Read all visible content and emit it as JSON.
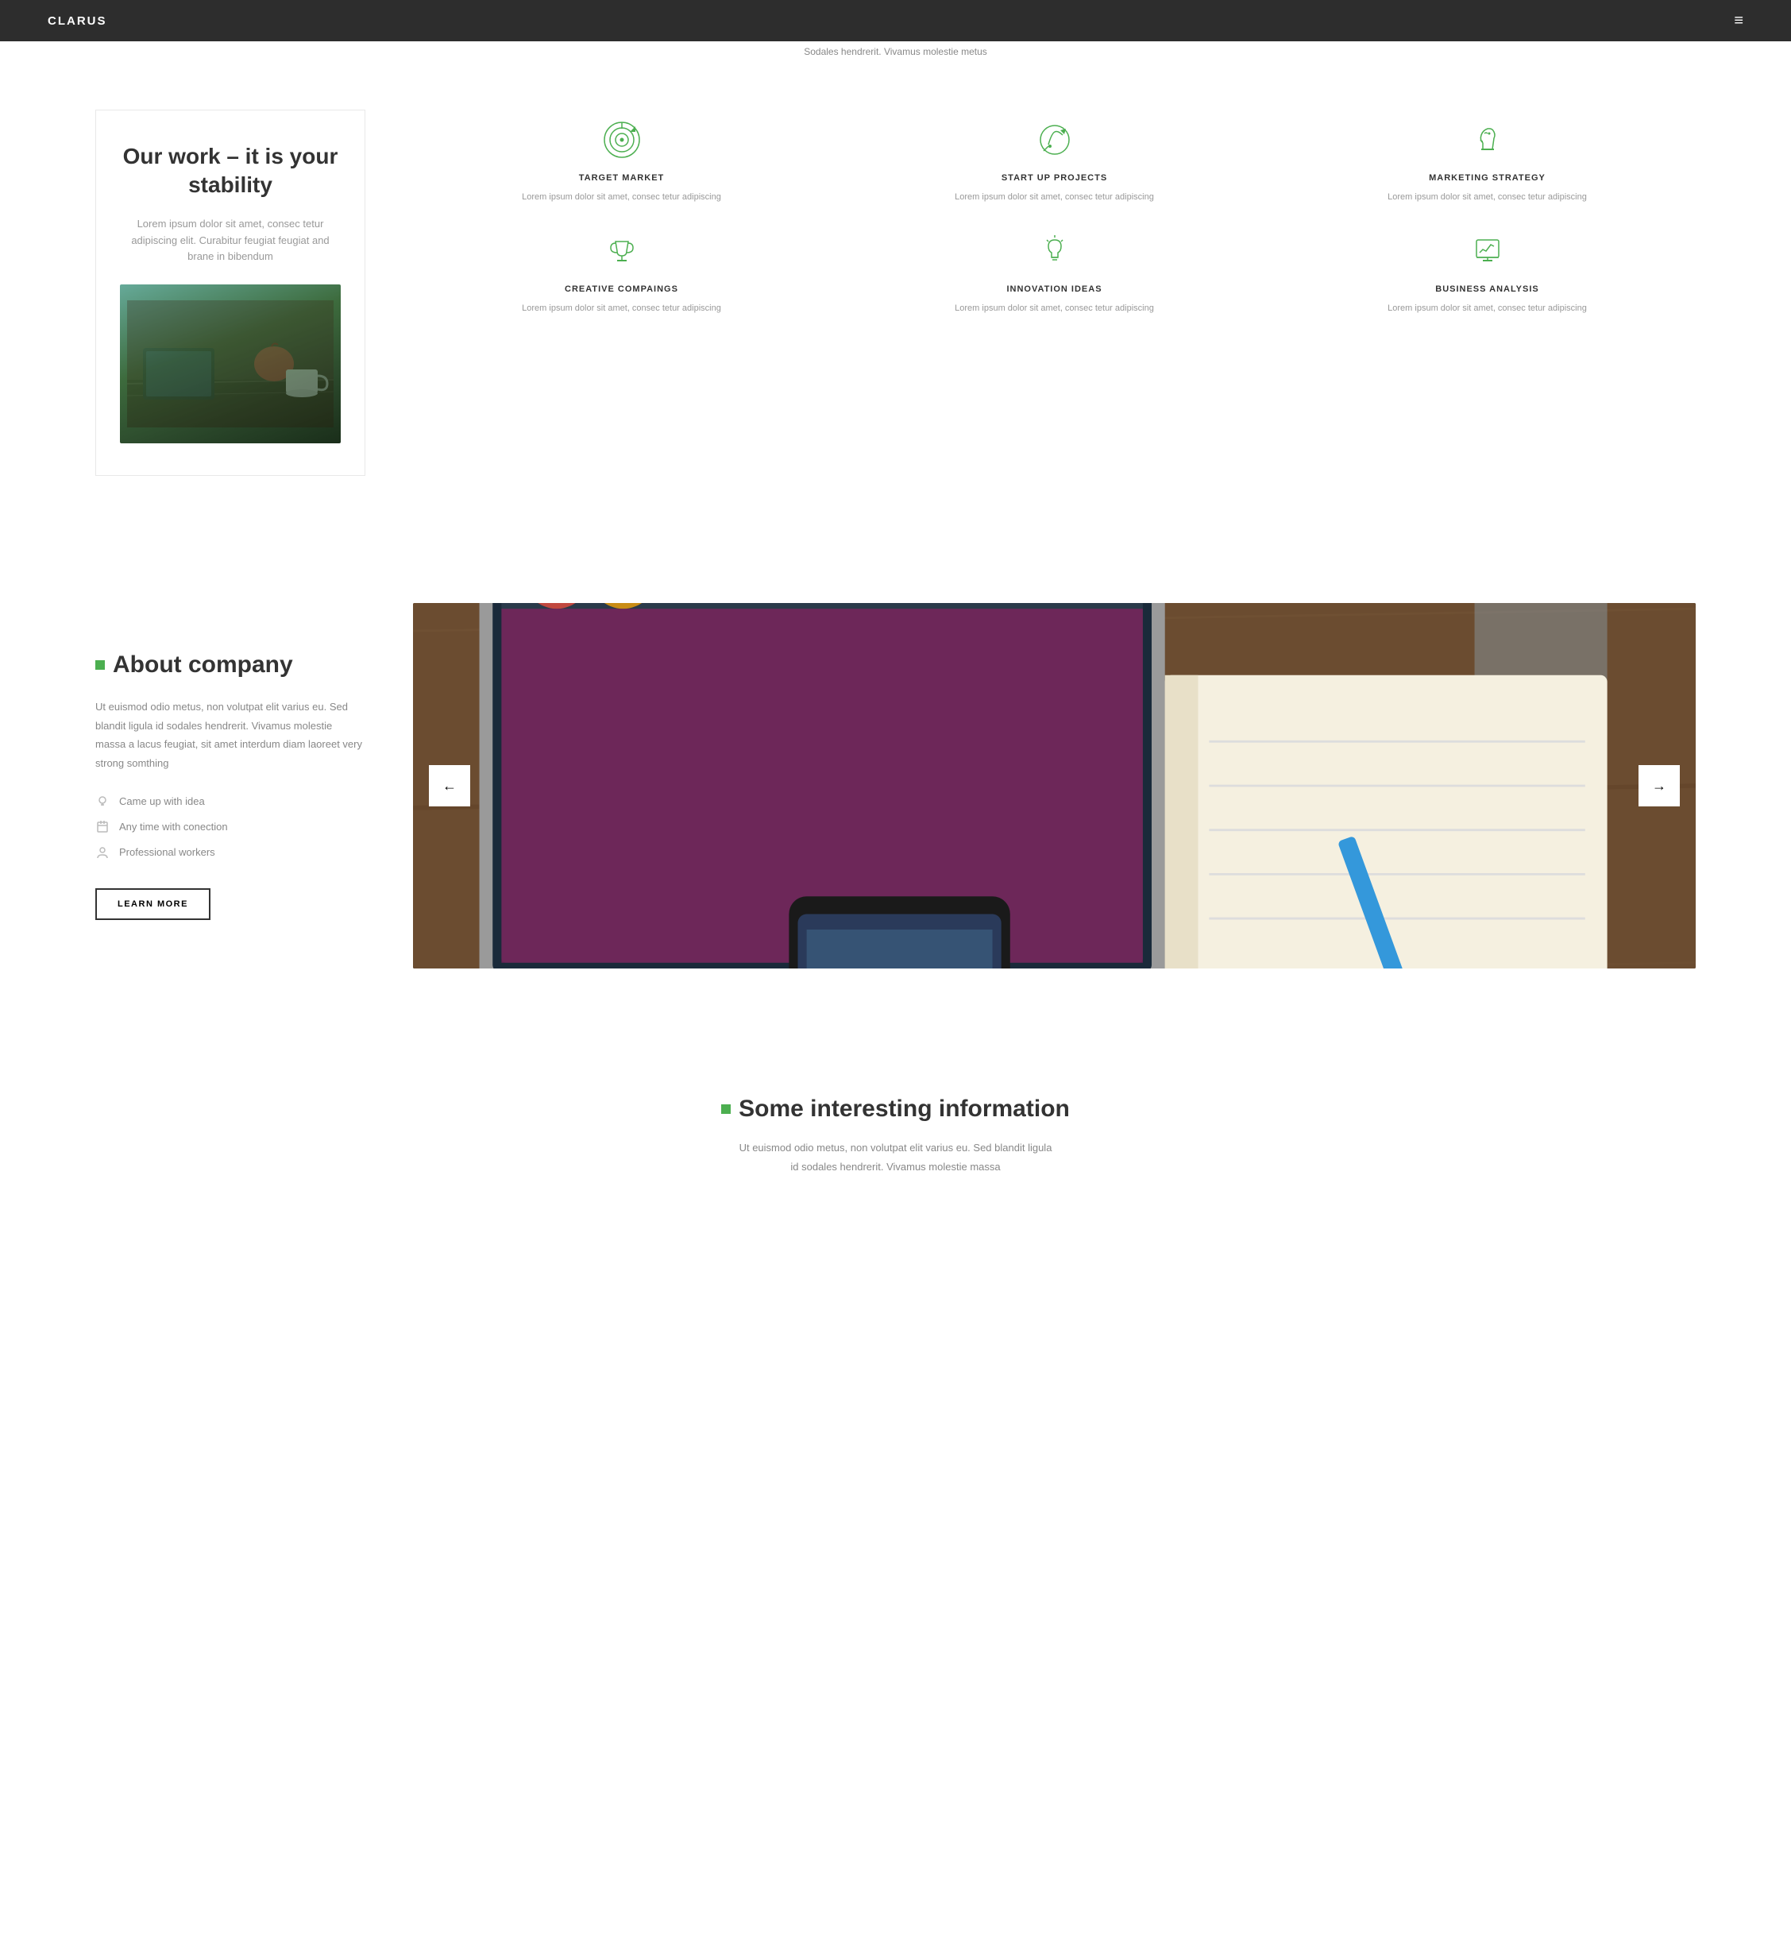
{
  "nav": {
    "logo": "CLARUS",
    "menu_icon": "≡"
  },
  "ticker": {
    "text": "Sodales hendrerit. Vivamus molestie metus"
  },
  "section_work": {
    "title": "Our work – it is your stability",
    "description": "Lorem ipsum dolor sit amet, consec tetur adipiscing elit. Curabitur feugiat feugiat and brane in bibendum",
    "features": [
      {
        "id": "target-market",
        "title": "TARGET MARKET",
        "description": "Lorem ipsum dolor sit amet, consec tetur adipiscing"
      },
      {
        "id": "startup-projects",
        "title": "START UP PROJECTS",
        "description": "Lorem ipsum dolor sit amet, consec tetur adipiscing"
      },
      {
        "id": "marketing-strategy",
        "title": "MARKETING STRATEGY",
        "description": "Lorem ipsum dolor sit amet, consec tetur adipiscing"
      },
      {
        "id": "creative-campaigns",
        "title": "CREATIVE COMPAINGS",
        "description": "Lorem ipsum dolor sit amet, consec tetur adipiscing"
      },
      {
        "id": "innovation-ideas",
        "title": "INNOVATION IDEAS",
        "description": "Lorem ipsum dolor sit amet, consec tetur adipiscing"
      },
      {
        "id": "business-analysis",
        "title": "BUSINESS ANALYSIS",
        "description": "Lorem ipsum dolor sit amet, consec tetur adipiscing"
      }
    ]
  },
  "section_about": {
    "heading": "About company",
    "description": "Ut euismod odio metus, non volutpat elit varius eu. Sed blandit ligula id sodales hendrerit. Vivamus molestie massa a lacus feugiat, sit amet interdum diam laoreet very strong somthing",
    "list_items": [
      {
        "id": "came-up",
        "text": "Came up with idea"
      },
      {
        "id": "any-time",
        "text": "Any time with conection"
      },
      {
        "id": "professional",
        "text": "Professional workers"
      }
    ],
    "button_label": "LEARN MORE",
    "carousel_prev": "←",
    "carousel_next": "→"
  },
  "section_info": {
    "heading": "Some interesting information",
    "description": "Ut euismod odio metus, non volutpat elit varius eu. Sed blandit ligula id sodales hendrerit. Vivamus molestie massa"
  }
}
